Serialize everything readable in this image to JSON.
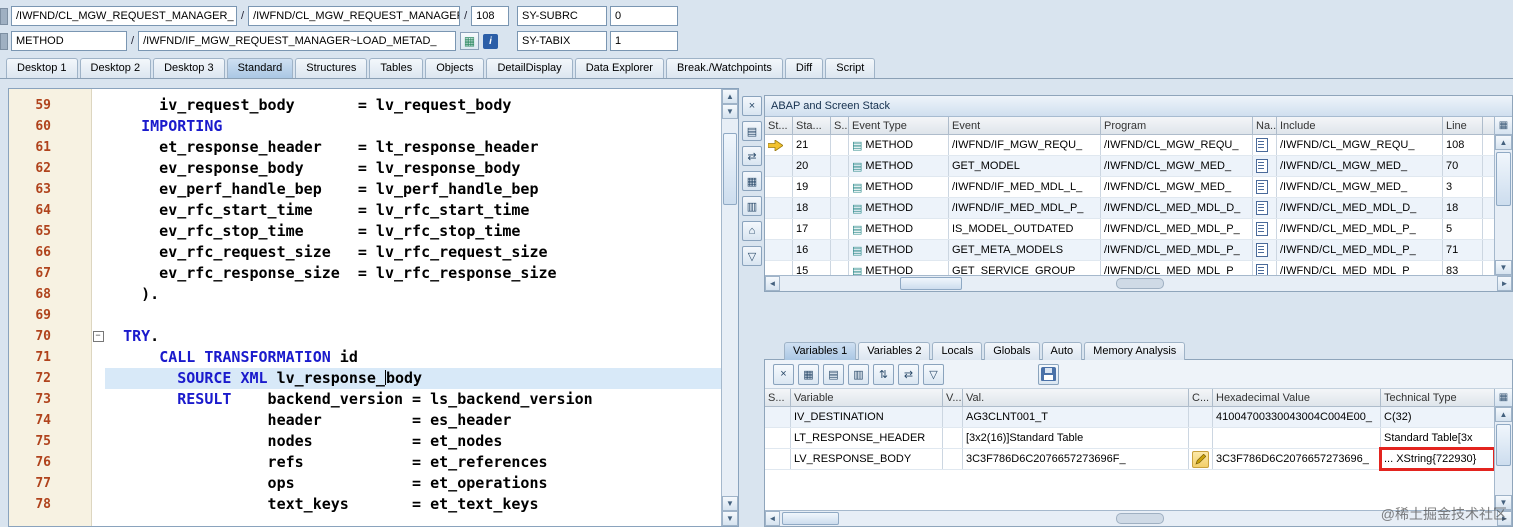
{
  "header": {
    "row1": {
      "class_field": "/IWFND/CL_MGW_REQUEST_MANAGER_",
      "slash1": "/",
      "program_field": "/IWFND/CL_MGW_REQUEST_MANAGER_",
      "slash2": "/",
      "line_field": "108",
      "syfield_label": "SY-SUBRC",
      "syfield_value": "0"
    },
    "row2": {
      "event_field": "METHOD",
      "slash": "/",
      "method_field": "/IWFND/IF_MGW_REQUEST_MANAGER~LOAD_METAD_",
      "syfield_label": "SY-TABIX",
      "syfield_value": "1"
    }
  },
  "tabs": {
    "selected": "Standard",
    "items": [
      "Desktop 1",
      "Desktop 2",
      "Desktop 3",
      "Standard",
      "Structures",
      "Tables",
      "Objects",
      "DetailDisplay",
      "Data Explorer",
      "Break./Watchpoints",
      "Diff",
      "Script"
    ]
  },
  "editor": {
    "lines": [
      {
        "no": "59",
        "seg": [
          {
            "t": "      iv_request_body       = lv_request_body"
          }
        ]
      },
      {
        "no": "60",
        "seg": [
          {
            "t": "    "
          },
          {
            "t": "IMPORTING",
            "k": 1
          }
        ]
      },
      {
        "no": "61",
        "seg": [
          {
            "t": "      et_response_header    = lt_response_header"
          }
        ]
      },
      {
        "no": "62",
        "seg": [
          {
            "t": "      ev_response_body      = lv_response_body"
          }
        ]
      },
      {
        "no": "63",
        "seg": [
          {
            "t": "      ev_perf_handle_bep    = lv_perf_handle_bep"
          }
        ]
      },
      {
        "no": "64",
        "seg": [
          {
            "t": "      ev_rfc_start_time     = lv_rfc_start_time"
          }
        ]
      },
      {
        "no": "65",
        "seg": [
          {
            "t": "      ev_rfc_stop_time      = lv_rfc_stop_time"
          }
        ]
      },
      {
        "no": "66",
        "seg": [
          {
            "t": "      ev_rfc_request_size   = lv_rfc_request_size"
          }
        ]
      },
      {
        "no": "67",
        "seg": [
          {
            "t": "      ev_rfc_response_size  = lv_rfc_response_size"
          }
        ]
      },
      {
        "no": "68",
        "seg": [
          {
            "t": "    )."
          }
        ]
      },
      {
        "no": "69",
        "seg": []
      },
      {
        "no": "70",
        "fold": 1,
        "seg": [
          {
            "t": "  "
          },
          {
            "t": "TRY",
            "k": 1
          },
          {
            "t": "."
          }
        ]
      },
      {
        "no": "71",
        "seg": [
          {
            "t": "      "
          },
          {
            "t": "CALL TRANSFORMATION",
            "k": 1
          },
          {
            "t": " id"
          }
        ]
      },
      {
        "no": "72",
        "current": 1,
        "seg": [
          {
            "t": "        "
          },
          {
            "t": "SOURCE XML",
            "k": 1
          },
          {
            "t": " lv_response_"
          },
          {
            "caret": 1
          },
          {
            "t": "body"
          }
        ]
      },
      {
        "no": "73",
        "seg": [
          {
            "t": "        "
          },
          {
            "t": "RESULT",
            "k": 1
          },
          {
            "t": "    backend_version = ls_backend_version"
          }
        ]
      },
      {
        "no": "74",
        "seg": [
          {
            "t": "                  header          = es_header"
          }
        ]
      },
      {
        "no": "75",
        "seg": [
          {
            "t": "                  nodes           = et_nodes"
          }
        ]
      },
      {
        "no": "76",
        "seg": [
          {
            "t": "                  refs            = et_references"
          }
        ]
      },
      {
        "no": "77",
        "seg": [
          {
            "t": "                  ops             = et_operations"
          }
        ]
      },
      {
        "no": "78",
        "seg": [
          {
            "t": "                  text_keys       = et_text_keys"
          }
        ]
      }
    ]
  },
  "stack": {
    "title": "ABAP and Screen Stack",
    "columns": [
      "St...",
      "Sta...",
      "S...",
      "Event Type",
      "Event",
      "Program",
      "Na...",
      "Include",
      "Line"
    ],
    "rows": [
      {
        "current": true,
        "stack_no": "21",
        "event_type": "METHOD",
        "event": "/IWFND/IF_MGW_REQU_",
        "program": "/IWFND/CL_MGW_REQU_",
        "include": "/IWFND/CL_MGW_REQU_",
        "line": "108"
      },
      {
        "stack_no": "20",
        "event_type": "METHOD",
        "event": "GET_MODEL",
        "program": "/IWFND/CL_MGW_MED_",
        "include": "/IWFND/CL_MGW_MED_",
        "line": "70"
      },
      {
        "stack_no": "19",
        "event_type": "METHOD",
        "event": "/IWFND/IF_MED_MDL_L_",
        "program": "/IWFND/CL_MGW_MED_",
        "include": "/IWFND/CL_MGW_MED_",
        "line": "3"
      },
      {
        "stack_no": "18",
        "event_type": "METHOD",
        "event": "/IWFND/IF_MED_MDL_P_",
        "program": "/IWFND/CL_MED_MDL_D_",
        "include": "/IWFND/CL_MED_MDL_D_",
        "line": "18"
      },
      {
        "stack_no": "17",
        "event_type": "METHOD",
        "event": "IS_MODEL_OUTDATED",
        "program": "/IWFND/CL_MED_MDL_P_",
        "include": "/IWFND/CL_MED_MDL_P_",
        "line": "5"
      },
      {
        "stack_no": "16",
        "event_type": "METHOD",
        "event": "GET_META_MODELS",
        "program": "/IWFND/CL_MED_MDL_P_",
        "include": "/IWFND/CL_MED_MDL_P_",
        "line": "71"
      },
      {
        "stack_no": "15",
        "event_type": "METHOD",
        "event": "GET_SERVICE_GROUP",
        "program": "/IWFND/CL_MED_MDL_P_",
        "include": "/IWFND/CL_MED_MDL_P_",
        "line": "83"
      }
    ]
  },
  "variables": {
    "tabs": [
      "Variables 1",
      "Variables 2",
      "Locals",
      "Globals",
      "Auto",
      "Memory Analysis"
    ],
    "selected": "Variables 1",
    "columns": [
      "S...",
      "Variable",
      "V...",
      "Val.",
      "C...",
      "Hexadecimal Value",
      "Technical Type"
    ],
    "rows": [
      {
        "variable": "IV_DESTINATION",
        "val": "AG3CLNT001_T",
        "hex": "41004700330043004C004E00_",
        "tech": "C(32)"
      },
      {
        "variable": "LT_RESPONSE_HEADER",
        "val": "[3x2(16)]Standard Table",
        "hex": "",
        "tech": "Standard Table[3x"
      },
      {
        "variable": "LV_RESPONSE_BODY",
        "val": "3C3F786D6C2076657273696F_",
        "hex": "3C3F786D6C2076657273696_",
        "tech": "... XString{722930}",
        "editable": true,
        "annotated": true
      }
    ]
  },
  "editor_tools": [
    {
      "name": "close-icon",
      "glyph": "×"
    },
    {
      "name": "new-document-icon",
      "glyph": "▤"
    },
    {
      "name": "swap-layout-icon",
      "glyph": "⇄"
    },
    {
      "name": "grid-display-icon",
      "glyph": "▦"
    },
    {
      "name": "table-display-icon",
      "glyph": "▥"
    },
    {
      "name": "goto-statement-icon",
      "glyph": "⌂"
    },
    {
      "name": "filter-icon",
      "glyph": "▽"
    }
  ],
  "var_toolbar": [
    {
      "name": "delete-variable-icon",
      "glyph": "×"
    },
    {
      "name": "grid-icon",
      "glyph": "▦"
    },
    {
      "name": "insert-row-icon",
      "glyph": "▤"
    },
    {
      "name": "columns-icon",
      "glyph": "▥"
    },
    {
      "name": "sort-icon",
      "glyph": "⇅"
    },
    {
      "name": "swap-icon",
      "glyph": "⇄"
    },
    {
      "name": "filter-icon",
      "glyph": "▽"
    }
  ],
  "icons": {
    "up": "▲",
    "down": "▼",
    "left": "◄",
    "right": "►",
    "grid": "▦",
    "rows": "▤",
    "cols": "▥",
    "swap": "⇄",
    "sort": "⇅",
    "filter": "▽",
    "close": "×",
    "info": "i",
    "fold": "−",
    "home": "⌂"
  },
  "watermark": "@稀土掘金技术社区",
  "colors": {
    "keyword": "#1a1acc",
    "line_number": "#b0431c",
    "current_line": "#d8e9f8",
    "annotation": "#e3241f",
    "accent": "#2b5ea7"
  }
}
